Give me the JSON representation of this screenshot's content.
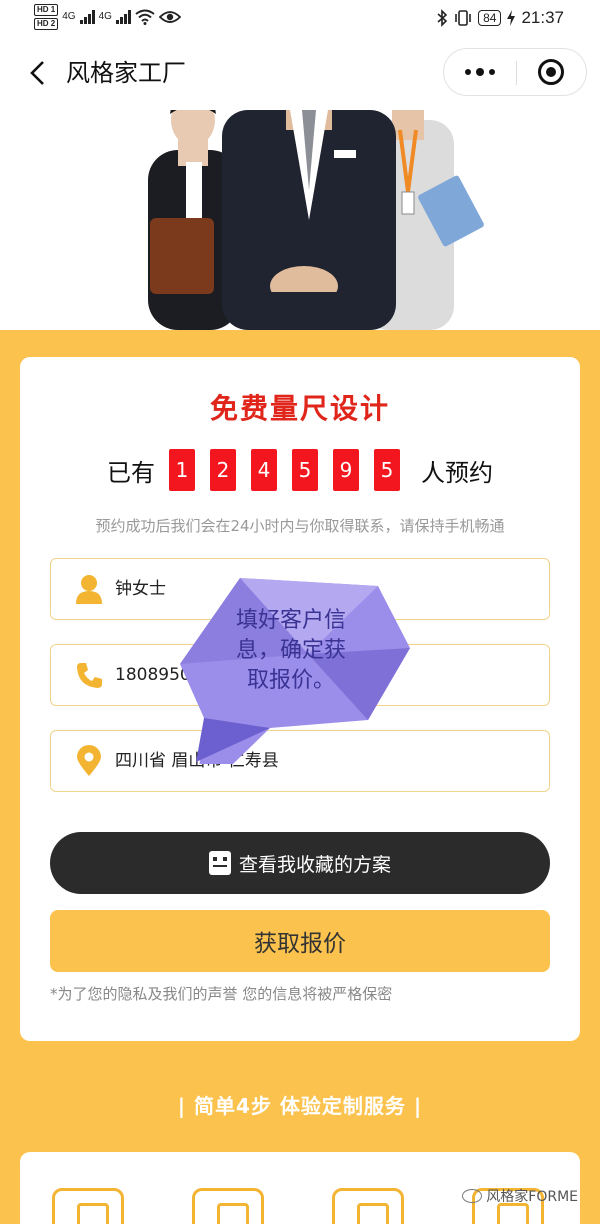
{
  "status_bar": {
    "hd_labels": [
      "HD 1",
      "HD 2"
    ],
    "network": [
      "4G",
      "4G"
    ],
    "battery": "84",
    "time": "21:37"
  },
  "nav": {
    "title": "风格家工厂"
  },
  "form": {
    "title": "免费量尺设计",
    "counter_prefix": "已有",
    "counter_digits": [
      "1",
      "2",
      "4",
      "5",
      "9",
      "5"
    ],
    "counter_suffix": "人预约",
    "notice": "预约成功后我们会在24小时内与你取得联系，请保持手机畅通",
    "name_value": "钟女士",
    "phone_value": "1808950",
    "region_value": "四川省 眉山市 仁寿县",
    "favorites_button": "查看我收藏的方案",
    "quote_button": "获取报价",
    "privacy_note": "*为了您的隐私及我们的声誉 您的信息将被严格保密"
  },
  "overlay": {
    "bubble_text": [
      "填好客户信",
      "息，确定获",
      "取报价。"
    ]
  },
  "steps": {
    "heading": "| 简单4步 体验定制服务 |"
  },
  "watermark": "风格家FORME",
  "colors": {
    "accent_yellow": "#fbc34e",
    "title_red": "#e0261b",
    "digit_red": "#f4161e",
    "dark_button": "#2b2b2b"
  }
}
